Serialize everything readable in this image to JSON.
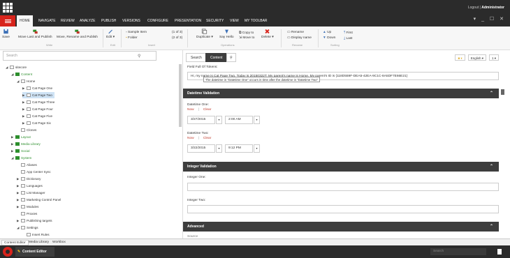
{
  "user_bar": {
    "logout": "Logout",
    "separator": "|",
    "user": "Administrator"
  },
  "window_controls": "▾ _ ☐ ✕",
  "ribbon_tabs": [
    "HOME",
    "NAVIGATE",
    "REVIEW",
    "ANALYZE",
    "PUBLISH",
    "VERSIONS",
    "CONFIGURE",
    "PRESENTATION",
    "SECURITY",
    "VIEW",
    "MY TOOLBAR"
  ],
  "ribbon": {
    "save": "Save",
    "move_last": "Move Last and Publish",
    "move_rename": "Move, Rename and Publish",
    "edit": "Edit ▾",
    "insert_items": [
      "Sample Item",
      "Folder"
    ],
    "insert_counts": [
      "(1 of 3)",
      "(2 of 3)"
    ],
    "duplicate": "Duplicate ▾",
    "say_hello": "Say Hello",
    "copy_to": "Copy to",
    "move_to": "Move to",
    "delete": "Delete ▾",
    "rename": "Rename",
    "display_name": "Display name",
    "up": "Up",
    "down": "Down",
    "first": "First",
    "last": "Last",
    "groups": [
      "Write",
      "Edit",
      "Insert",
      "Operations",
      "Rename",
      "Sorting"
    ]
  },
  "search": {
    "placeholder": "Search"
  },
  "tree": [
    {
      "label": "sitecore",
      "indent": 0,
      "toggle": "◢"
    },
    {
      "label": "Content",
      "indent": 1,
      "toggle": "◢",
      "color": "#2d8f2d"
    },
    {
      "label": "Home",
      "indent": 2,
      "toggle": "◢"
    },
    {
      "label": "Cat Page One",
      "indent": 3,
      "toggle": "▶"
    },
    {
      "label": "Cat Page Two",
      "indent": 3,
      "toggle": "▶",
      "selected": true
    },
    {
      "label": "Cat Page Three",
      "indent": 3,
      "toggle": "▶"
    },
    {
      "label": "Cat Page Four",
      "indent": 3,
      "toggle": "▶"
    },
    {
      "label": "Cat Page Five",
      "indent": 3,
      "toggle": "▶"
    },
    {
      "label": "Cat Page Six",
      "indent": 3,
      "toggle": "▶"
    },
    {
      "label": "Clones",
      "indent": 2,
      "toggle": ""
    },
    {
      "label": "Layout",
      "indent": 1,
      "toggle": "▶",
      "color": "#2d8f2d"
    },
    {
      "label": "Media Library",
      "indent": 1,
      "toggle": "▶",
      "color": "#2d8f2d"
    },
    {
      "label": "Social",
      "indent": 1,
      "toggle": "▶",
      "color": "#2d8f2d"
    },
    {
      "label": "System",
      "indent": 1,
      "toggle": "◢",
      "color": "#2d8f2d"
    },
    {
      "label": "Aliases",
      "indent": 2,
      "toggle": ""
    },
    {
      "label": "App Center Sync",
      "indent": 2,
      "toggle": ""
    },
    {
      "label": "Dictionary",
      "indent": 2,
      "toggle": "▶"
    },
    {
      "label": "Languages",
      "indent": 2,
      "toggle": "▶"
    },
    {
      "label": "List Manager",
      "indent": 2,
      "toggle": "▶"
    },
    {
      "label": "Marketing Control Panel",
      "indent": 2,
      "toggle": "▶"
    },
    {
      "label": "Modules",
      "indent": 2,
      "toggle": "▶"
    },
    {
      "label": "Proxies",
      "indent": 2,
      "toggle": ""
    },
    {
      "label": "Publishing targets",
      "indent": 2,
      "toggle": "▶"
    },
    {
      "label": "Settings",
      "indent": 2,
      "toggle": "◢"
    },
    {
      "label": "Insert Rules",
      "indent": 3,
      "toggle": ""
    }
  ],
  "editor_tabs": {
    "search": "Search",
    "content": "Content"
  },
  "language": "English ▾",
  "version": "1 ▾",
  "fields": {
    "tokens_label": "Field Full Of Tokens:",
    "tokens_value": "Hi, my name is Cat Page Two. Today is 20150322T. My parent's name is Home. My parent's ID is {118D559F-DEA5-42EA-9C1C-8A5DF7E66E21}",
    "datetime_section": "Datetime Validation",
    "dt_one_label": "Datetime One:",
    "dt_two_label": "Datetime Two:",
    "now": "Now",
    "clear": "Clear",
    "dt_one_date": "3/27/2015",
    "dt_one_time": "2:00 AM",
    "dt_two_date": "3/22/2015",
    "dt_two_time": "9:12 PM",
    "tooltip": "The datetime in \"Datetime One\" occurs in time after the datetime in \"Datetime Two\"",
    "integer_section": "Integer Validation",
    "int_one_label": "Integer One:",
    "int_two_label": "Integer Two:",
    "advanced_section": "Advanced",
    "source_label": "Source"
  },
  "statusbar": [
    "Content Editor",
    "Media Library",
    "Workbox"
  ],
  "taskbar": {
    "item": "Content Editor",
    "search": "Search"
  },
  "colors": {
    "accent": "#d8241c",
    "dark": "#2b2b2b",
    "section": "#3d3d3d",
    "link": "#c0392b"
  }
}
